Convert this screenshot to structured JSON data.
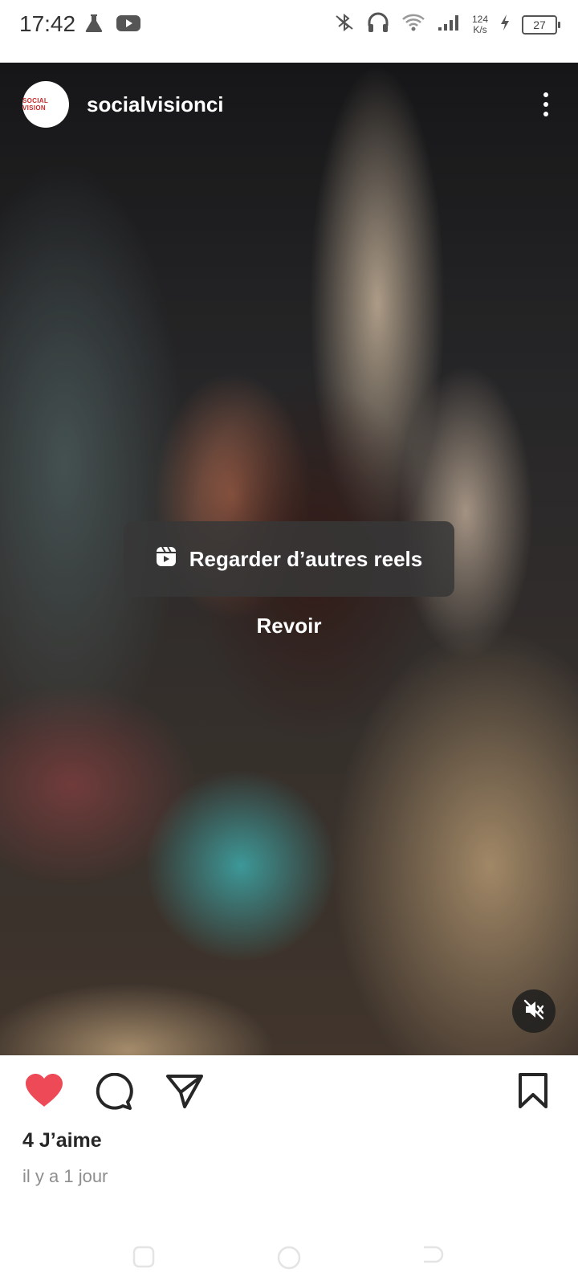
{
  "status_bar": {
    "time": "17:42",
    "net_speed_value": "124",
    "net_speed_unit": "K/s",
    "battery": "27",
    "icons": [
      "flask-icon",
      "youtube-icon",
      "bluetooth-off-icon",
      "headphones-icon",
      "wifi-icon",
      "signal-icon",
      "charging-icon"
    ]
  },
  "post": {
    "username": "socialvisionci",
    "avatar_text": "SOCIAL VISION"
  },
  "overlay": {
    "reels_label": "Regarder d’autres reels",
    "replay_label": "Revoir"
  },
  "actions": {
    "liked": true,
    "like_color": "#ed4956"
  },
  "meta": {
    "likes": "4 J’aime",
    "timestamp": "il y a 1 jour"
  }
}
